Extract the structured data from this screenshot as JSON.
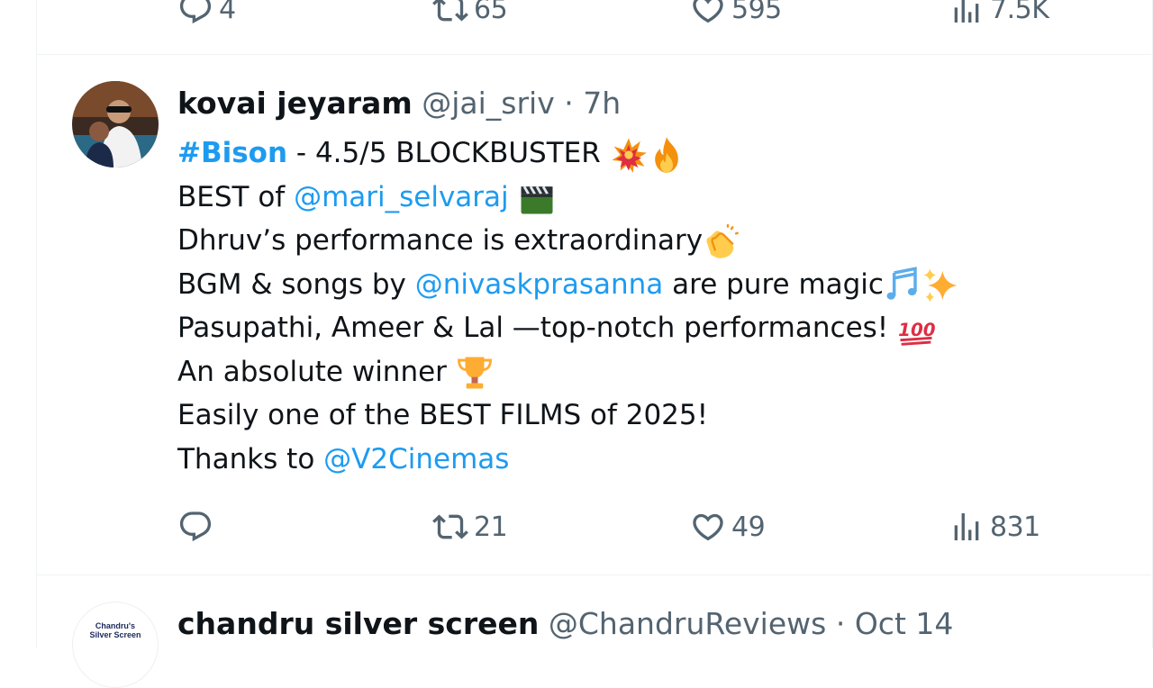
{
  "colors": {
    "link": "#1d9bf0",
    "muted": "#536471",
    "text": "#0f1419",
    "like": "#f91880"
  },
  "previous_tweet": {
    "actions": {
      "replies": "4",
      "retweets": "65",
      "likes": "595",
      "views": "7.5K"
    }
  },
  "tweet": {
    "author": {
      "name": "kovai jeyaram",
      "handle": "@jai_sriv",
      "time": "7h"
    },
    "separator": "·",
    "hashtag": "#Bison",
    "line1_text": " - 4.5/5 BLOCKBUSTER ",
    "line2_prefix": "BEST of ",
    "mention1": "@mari_selvaraj",
    "line3_text": "Dhruv’s performance is extraordinary",
    "line4_prefix": "BGM & songs by ",
    "mention2": "@nivaskprasanna",
    "line4_suffix": " are pure magic",
    "line5_text": "Pasupathi, Ameer & Lal —top-notch performances! ",
    "line6_text": "An absolute winner ",
    "line7_text": "Easily one of the BEST FILMS of 2025!",
    "line8_prefix": "Thanks to ",
    "mention3": "@V2Cinemas",
    "actions": {
      "replies": "",
      "retweets": "21",
      "likes": "49",
      "views": "831"
    }
  },
  "next_tweet": {
    "author": {
      "name": "chandru silver screen",
      "handle": "@ChandruReviews",
      "time": "Oct 14"
    },
    "separator": "·",
    "avatar_text_1": "Chandru's",
    "avatar_text_2": "Silver Screen"
  },
  "icons": [
    "reply-icon",
    "retweet-icon",
    "like-icon",
    "views-icon",
    "collision-emoji",
    "fire-emoji",
    "clapper-emoji",
    "clap-emoji",
    "music-notes-emoji",
    "sparkles-emoji",
    "hundred-emoji",
    "trophy-emoji"
  ]
}
